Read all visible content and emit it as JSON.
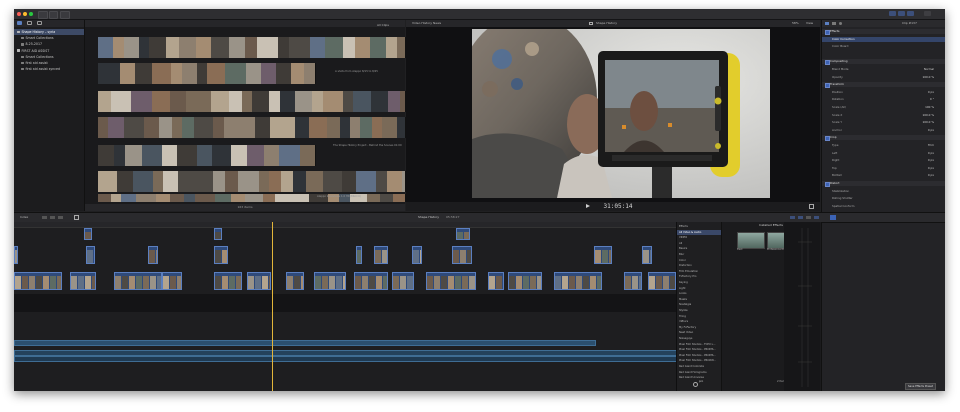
{
  "window": {
    "title": "Shape History"
  },
  "toolbar": {
    "library_path_label": "All Clips",
    "search_label": "Video History News",
    "viewer_zoom": "58%",
    "view_label": "View",
    "clip_label": "Clip #137"
  },
  "library": {
    "items": [
      {
        "label": "Shape History – syria",
        "level": 0,
        "selected": true
      },
      {
        "label": "Smart Collections",
        "level": 1,
        "selected": false
      },
      {
        "label": "8-25-2017",
        "level": 1,
        "selected": false
      },
      {
        "label": "FIRST AID ASSIST",
        "level": 0,
        "selected": false
      },
      {
        "label": "Smart Collections",
        "level": 1,
        "selected": false
      },
      {
        "label": "first aid assist",
        "level": 1,
        "selected": false
      },
      {
        "label": "first aid assist synced",
        "level": 1,
        "selected": false
      }
    ]
  },
  "browser": {
    "captions": [
      "A shots from Aleppo 8/15 to 8/25",
      "The Shape History Project - Behind the Scenes 01:00",
      "Aleppo Interviews 1.0 HD(BRACO)"
    ],
    "footer": "163 items"
  },
  "viewer": {
    "timecode": "31:05:14"
  },
  "timeline": {
    "index_label": "Index",
    "project_label": "Shape History",
    "duration_label": "05:58:27"
  },
  "inspector": {
    "rows": [
      {
        "label": "Effects",
        "value": "",
        "type": "section"
      },
      {
        "label": "Color Correction",
        "value": "",
        "type": "selected"
      },
      {
        "label": "Color Board",
        "value": "",
        "type": "row"
      },
      {
        "label": "",
        "value": "",
        "type": "blank"
      },
      {
        "label": "Compositing",
        "value": "",
        "type": "section"
      },
      {
        "label": "Blend Mode",
        "value": "Normal",
        "type": "row"
      },
      {
        "label": "Opacity",
        "value": "100.0 %",
        "type": "row"
      },
      {
        "label": "Transform",
        "value": "",
        "type": "section"
      },
      {
        "label": "Position",
        "value": "0 px",
        "type": "row"
      },
      {
        "label": "Rotation",
        "value": "0 °",
        "type": "row"
      },
      {
        "label": "Scale (All)",
        "value": "100 %",
        "type": "row"
      },
      {
        "label": "Scale X",
        "value": "100.0 %",
        "type": "row"
      },
      {
        "label": "Scale Y",
        "value": "100.0 %",
        "type": "row"
      },
      {
        "label": "Anchor",
        "value": "0 px",
        "type": "row"
      },
      {
        "label": "Crop",
        "value": "",
        "type": "section"
      },
      {
        "label": "Type",
        "value": "Trim",
        "type": "row"
      },
      {
        "label": "Left",
        "value": "0 px",
        "type": "row"
      },
      {
        "label": "Right",
        "value": "0 px",
        "type": "row"
      },
      {
        "label": "Top",
        "value": "0 px",
        "type": "row"
      },
      {
        "label": "Bottom",
        "value": "0 px",
        "type": "row"
      },
      {
        "label": "Distort",
        "value": "",
        "type": "section"
      },
      {
        "label": "Stabilization",
        "value": "",
        "type": "row"
      },
      {
        "label": "Rolling Shutter",
        "value": "",
        "type": "row"
      },
      {
        "label": "Spatial Conform",
        "value": "",
        "type": "row"
      },
      {
        "label": "Rate Conform",
        "value": "",
        "type": "row"
      }
    ]
  },
  "effects": {
    "header": "Installed Effects",
    "categories": [
      {
        "label": "Effects",
        "selected": false
      },
      {
        "label": "All Video & Audio",
        "selected": true
      },
      {
        "label": "VIDEO",
        "selected": false
      },
      {
        "label": "All",
        "selected": false
      },
      {
        "label": "Basics",
        "selected": false
      },
      {
        "label": "Blur",
        "selected": false
      },
      {
        "label": "Color",
        "selected": false
      },
      {
        "label": "Distortion",
        "selected": false
      },
      {
        "label": "Film Emulation",
        "selected": false
      },
      {
        "label": "FxFactory Pro",
        "selected": false
      },
      {
        "label": "Keying",
        "selected": false
      },
      {
        "label": "Light",
        "selected": false
      },
      {
        "label": "Looks",
        "selected": false
      },
      {
        "label": "Masks",
        "selected": false
      },
      {
        "label": "Nostalgia",
        "selected": false
      },
      {
        "label": "Stylize",
        "selected": false
      },
      {
        "label": "Tiling",
        "selected": false
      },
      {
        "label": "mBlurs",
        "selected": false
      },
      {
        "label": "My FxFactory",
        "selected": false
      },
      {
        "label": "Neat Video",
        "selected": false
      },
      {
        "label": "Noiseguys",
        "selected": false
      },
      {
        "label": "Pixel Film Studios - FCPX L...",
        "selected": false
      },
      {
        "label": "Pixel Film Studios - PROMS...",
        "selected": false
      },
      {
        "label": "Pixel Film Studios - PROMS...",
        "selected": false
      },
      {
        "label": "Pixel Film Studios - PROXW...",
        "selected": false
      },
      {
        "label": "Red Giant Colorista",
        "selected": false
      },
      {
        "label": "Red Giant Holograms",
        "selected": false
      },
      {
        "label": "Red Giant Universe",
        "selected": false
      }
    ],
    "items": [
      {
        "label": "Dark"
      },
      {
        "label": "Professional Dark"
      }
    ],
    "search_label": "pro",
    "count_label": "2 Items",
    "save_preset_label": "Save Effects Preset"
  }
}
